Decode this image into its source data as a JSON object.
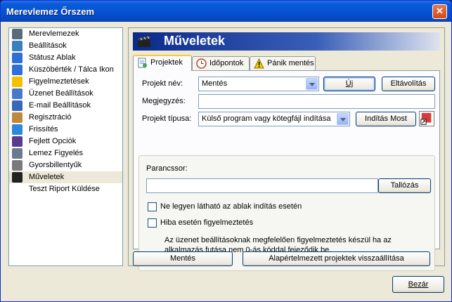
{
  "window": {
    "title": "Merevlemez Őrszem",
    "close_glyph": "✕"
  },
  "sidebar": {
    "items": [
      {
        "label": "Merevlemezek",
        "icon": "hard-disk-icon",
        "color": "#5a6a7a"
      },
      {
        "label": "Beállítások",
        "icon": "settings-icon",
        "color": "#3a7fc0"
      },
      {
        "label": "Státusz Ablak",
        "icon": "window-icon",
        "color": "#2f6fd8"
      },
      {
        "label": "Küszöbérték / Tálca Ikon",
        "icon": "tray-icon",
        "color": "#2f6fd8"
      },
      {
        "label": "Figyelmeztetések",
        "icon": "warning-icon",
        "color": "#f2c200"
      },
      {
        "label": "Üzenet Beállítások",
        "icon": "message-icon",
        "color": "#4a78c8"
      },
      {
        "label": "E-mail Beállítások",
        "icon": "email-icon",
        "color": "#3a68b8"
      },
      {
        "label": "Regisztráció",
        "icon": "registration-icon",
        "color": "#c0883a"
      },
      {
        "label": "Frissítés",
        "icon": "globe-icon",
        "color": "#2a8ad8"
      },
      {
        "label": "Fejlett Opciók",
        "icon": "advanced-icon",
        "color": "#5a3a8a"
      },
      {
        "label": "Lemez Figyelés",
        "icon": "monitor-icon",
        "color": "#6a7a8a"
      },
      {
        "label": "Gyorsbillentyűk",
        "icon": "keyboard-icon",
        "color": "#7a7a7a"
      },
      {
        "label": "Műveletek",
        "icon": "clapper-icon",
        "color": "#222222",
        "selected": true
      },
      {
        "label": "Teszt Riport Küldése",
        "icon": "",
        "color": ""
      }
    ]
  },
  "header": {
    "title": "Műveletek"
  },
  "tabs": [
    {
      "label": "Projektek",
      "icon": "document-icon",
      "active": true
    },
    {
      "label": "Időpontok",
      "icon": "clock-icon",
      "active": false
    },
    {
      "label": "Pánik mentés",
      "icon": "warning-icon",
      "active": false
    }
  ],
  "form": {
    "project_name_label": "Projekt név:",
    "project_name_value": "Mentés",
    "new_button": "Új",
    "remove_button": "Eltávolítás",
    "comment_label": "Megjegyzés:",
    "comment_value": "",
    "project_type_label": "Projekt típusa:",
    "project_type_value": "Külső program vagy kötegfájl indítása",
    "start_now_button": "Indítás Most",
    "command_line_label": "Parancssor:",
    "command_line_value": "",
    "browse_button": "Tallózás",
    "hide_window_label": "Ne legyen látható az ablak indítás esetén",
    "hide_window_checked": false,
    "warn_error_label": "Hiba esetén figyelmeztetés",
    "warn_error_checked": false,
    "note": "Az üzenet beállításoknak megfelelően figyelmeztetés készül ha az alkalmazás futása nem 0-ás kóddal fejeződik be."
  },
  "buttons": {
    "save": "Mentés",
    "restore_defaults": "Alapértelmezett projektek visszaállítása",
    "close": "Bezár"
  }
}
